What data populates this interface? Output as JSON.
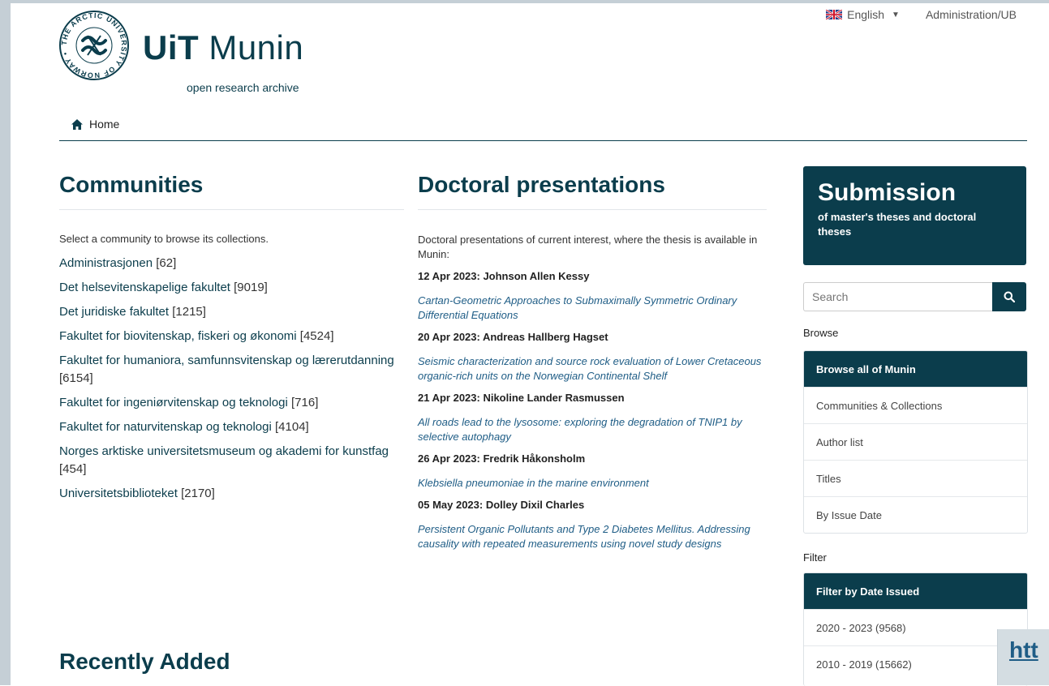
{
  "header": {
    "logo_seal_text": "THE ARCTIC UNIVERSITY OF NORWAY • UiT •",
    "logo_brand": "UiT",
    "logo_name": "Munin",
    "logo_subtitle": "open research archive",
    "language": "English",
    "admin_link": "Administration/UB"
  },
  "breadcrumb": {
    "home": "Home"
  },
  "communities": {
    "title": "Communities",
    "intro": "Select a community to browse its collections.",
    "items": [
      {
        "name": "Administrasjonen",
        "count": "[62]"
      },
      {
        "name": "Det helsevitenskapelige fakultet",
        "count": "[9019]"
      },
      {
        "name": "Det juridiske fakultet",
        "count": "[1215]"
      },
      {
        "name": "Fakultet for biovitenskap, fiskeri og økonomi",
        "count": "[4524]"
      },
      {
        "name": "Fakultet for humaniora, samfunnsvitenskap og lærerutdanning",
        "count": "[6154]"
      },
      {
        "name": "Fakultet for ingeniørvitenskap og teknologi",
        "count": "[716]"
      },
      {
        "name": "Fakultet for naturvitenskap og teknologi",
        "count": "[4104]"
      },
      {
        "name": "Norges arktiske universitetsmuseum og akademi for kunstfag",
        "count": "[454]"
      },
      {
        "name": "Universitetsbiblioteket",
        "count": "[2170]"
      }
    ]
  },
  "doctoral": {
    "title": "Doctoral presentations",
    "intro": "Doctoral presentations of current interest, where the thesis is available in Munin:",
    "items": [
      {
        "date": "12 Apr 2023: Johnson Allen Kessy",
        "title": "Cartan-Geometric Approaches to Submaximally Symmetric Ordinary Differential Equations"
      },
      {
        "date": "20 Apr 2023: Andreas Hallberg Hagset",
        "title": "Seismic characterization and source rock evaluation of Lower Cretaceous organic-rich units on the Norwegian Continental Shelf"
      },
      {
        "date": "21 Apr 2023: Nikoline Lander Rasmussen",
        "title": "All roads lead to the lysosome: exploring the degradation of TNIP1 by selective autophagy"
      },
      {
        "date": "26 Apr 2023: Fredrik Håkonsholm",
        "title": "Klebsiella pneumoniae in the marine environment"
      },
      {
        "date": "05 May 2023: Dolley Dixil Charles",
        "title": "Persistent Organic Pollutants and Type 2 Diabetes Mellitus. Addressing causality with repeated measurements using novel study designs"
      }
    ]
  },
  "recent": {
    "title": "Recently Added"
  },
  "sidebar": {
    "submission_title": "Submission",
    "submission_desc": "of master's theses and doctoral theses",
    "search_placeholder": "Search",
    "browse_label": "Browse",
    "browse_head": "Browse all of Munin",
    "browse_items": [
      "Communities & Collections",
      "Author list",
      "Titles",
      "By Issue Date"
    ],
    "filter_label": "Filter",
    "filter_head": "Filter by Date Issued",
    "filter_items": [
      "2020 - 2023 (9568)",
      "2010 - 2019 (15662)"
    ]
  },
  "overlay": {
    "corner_text": "htt"
  },
  "colors": {
    "brand": "#0b3d4c",
    "link": "#1f5d86"
  }
}
